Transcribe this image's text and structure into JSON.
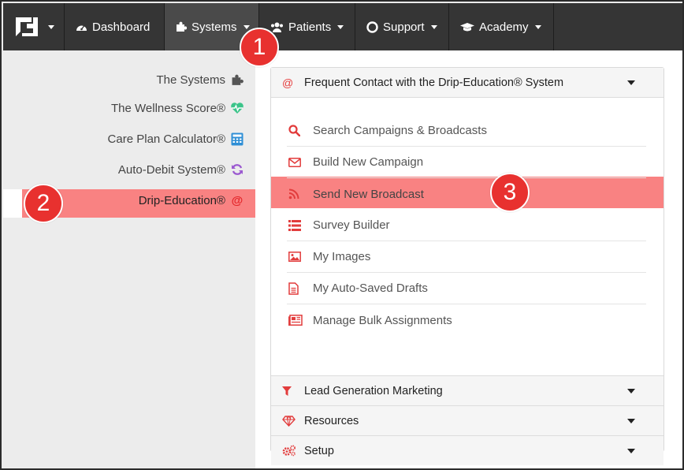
{
  "nav": {
    "items": [
      {
        "label": "Dashboard",
        "icon": "dashboard-icon"
      },
      {
        "label": "Systems",
        "icon": "puzzle-icon"
      },
      {
        "label": "Patients",
        "icon": "users-icon"
      },
      {
        "label": "Support",
        "icon": "lifebuoy-icon"
      },
      {
        "label": "Academy",
        "icon": "graduation-cap-icon"
      }
    ]
  },
  "sidebar": {
    "items": [
      {
        "label": "The Systems",
        "icon": "puzzle-icon"
      },
      {
        "label": "The Wellness Score®",
        "icon": "heartbeat-icon"
      },
      {
        "label": "Care Plan Calculator®",
        "icon": "calculator-icon"
      },
      {
        "label": "Auto-Debit System®",
        "icon": "refresh-icon"
      },
      {
        "label": "Drip-Education®",
        "icon": "at-icon"
      }
    ]
  },
  "panel": {
    "title": "Frequent Contact with the Drip-Education® System",
    "items": [
      {
        "label": "Search Campaigns & Broadcasts",
        "icon": "search-icon"
      },
      {
        "label": "Build New Campaign",
        "icon": "envelope-icon"
      },
      {
        "label": "Send New Broadcast",
        "icon": "rss-icon"
      },
      {
        "label": "Survey Builder",
        "icon": "list-icon"
      },
      {
        "label": "My Images",
        "icon": "image-icon"
      },
      {
        "label": "My Auto-Saved Drafts",
        "icon": "file-icon"
      },
      {
        "label": "Manage Bulk Assignments",
        "icon": "newspaper-icon"
      }
    ],
    "sections": [
      {
        "label": "Lead Generation Marketing",
        "icon": "filter-icon"
      },
      {
        "label": "Resources",
        "icon": "diamond-icon"
      },
      {
        "label": "Setup",
        "icon": "cogs-icon"
      }
    ]
  },
  "badges": [
    "1",
    "2",
    "3"
  ],
  "colors": {
    "nav_bg": "#353535",
    "highlight": "#f98282",
    "accent_red": "#e8312f"
  }
}
